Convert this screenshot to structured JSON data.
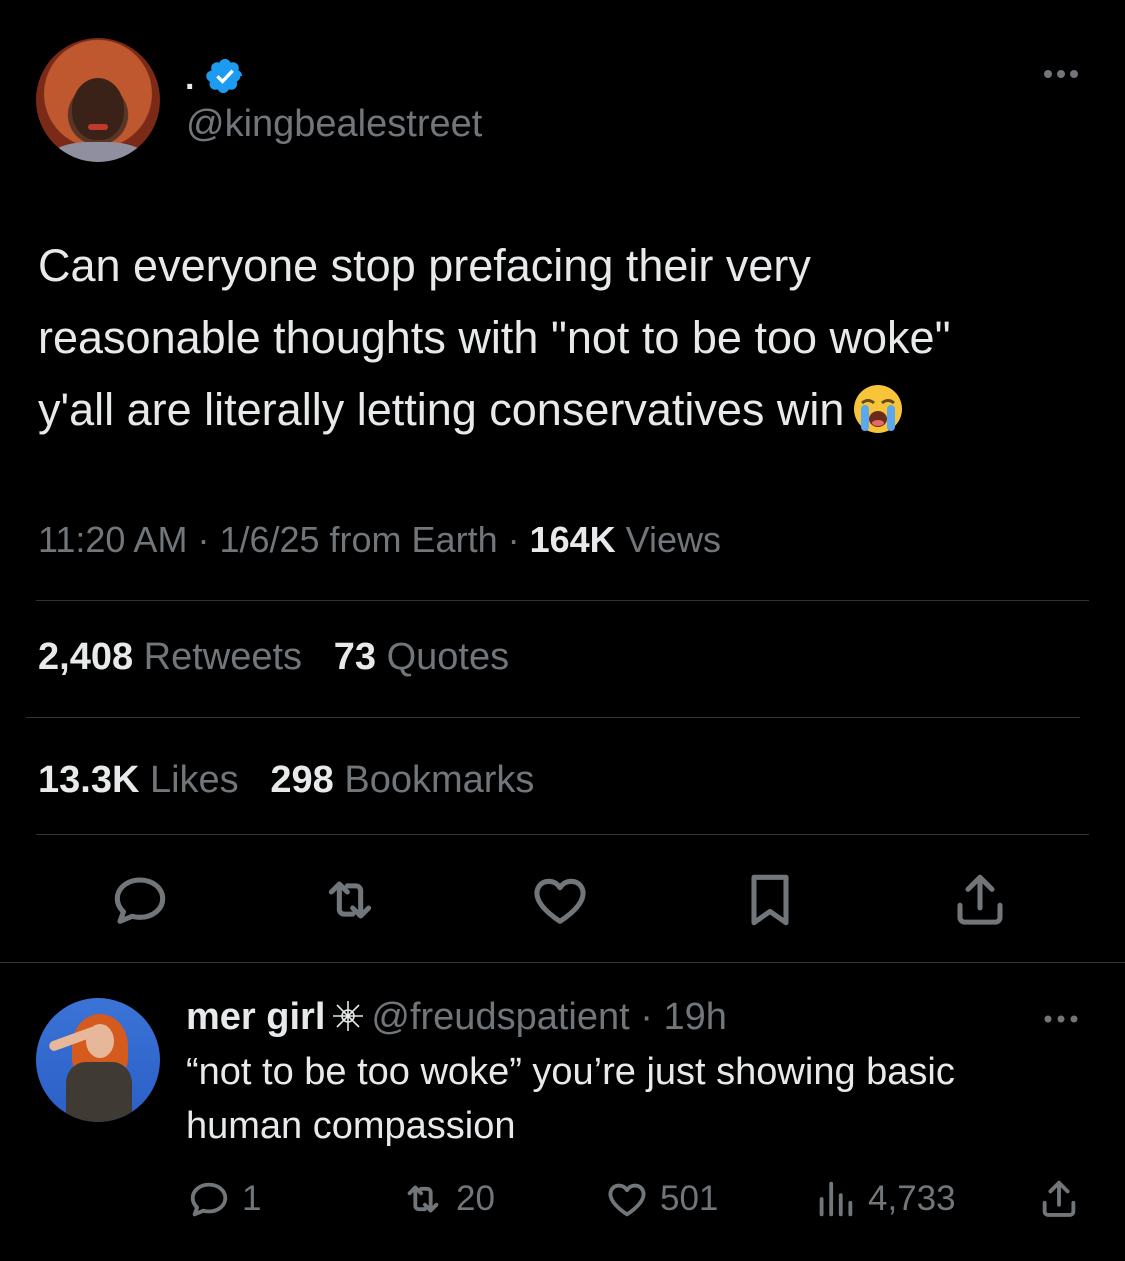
{
  "tweet": {
    "author_name": ".",
    "author_handle": "@kingbealestreet",
    "text_line1": "Can everyone stop prefacing their very",
    "text_line2": "reasonable thoughts with \"not to be too woke\"",
    "text_line3": "y'all are literally letting conservatives win",
    "emoji": "loudly-crying-face",
    "time": "11:20 AM",
    "date": "1/6/25",
    "location": "from Earth",
    "views_count": "164K",
    "views_label": "Views",
    "retweets_count": "2,408",
    "retweets_label": "Retweets",
    "quotes_count": "73",
    "quotes_label": "Quotes",
    "likes_count": "13.3K",
    "likes_label": "Likes",
    "bookmarks_count": "298",
    "bookmarks_label": "Bookmarks"
  },
  "actions": [
    "reply-icon",
    "retweet-icon",
    "like-icon",
    "bookmark-icon",
    "share-icon"
  ],
  "reply": {
    "author_name": "mer girl",
    "author_handle": "@freudspatient",
    "age": "19h",
    "text_line1": "“not to be too woke” you’re just showing basic",
    "text_line2": "human compassion",
    "reply_count": "1",
    "retweet_count": "20",
    "like_count": "501",
    "view_count": "4,733"
  },
  "colors": {
    "background": "#000000",
    "text_primary": "#e7e9ea",
    "text_secondary": "#71767b",
    "verified": "#1d9bf0",
    "divider": "#2f3336"
  }
}
